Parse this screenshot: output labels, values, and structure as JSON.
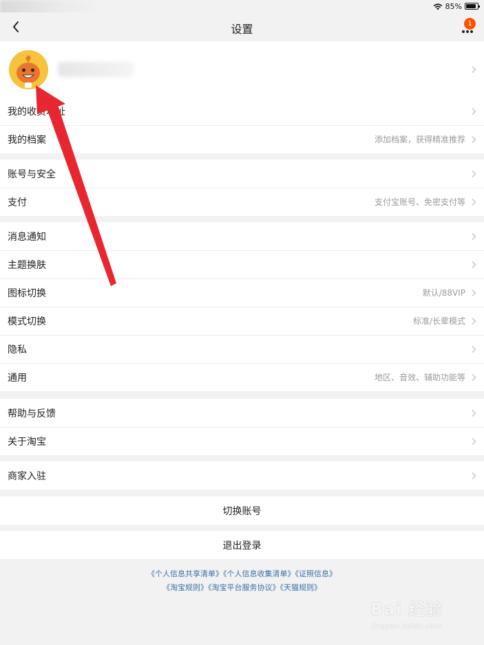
{
  "status_bar": {
    "battery": "85%",
    "battery_level": 0.85,
    "wifi_icon": "wifi-icon"
  },
  "nav": {
    "title": "设置",
    "badge": "1",
    "back_icon": "chevron-left-icon",
    "more_icon": "more-dots-icon"
  },
  "profile": {
    "chevron": "chevron-right-icon"
  },
  "group1": [
    {
      "label": "我的收货地址",
      "hint": ""
    },
    {
      "label": "我的档案",
      "hint": "添加档案，获得精准推荐"
    }
  ],
  "group2": [
    {
      "label": "账号与安全",
      "hint": ""
    },
    {
      "label": "支付",
      "hint": "支付宝账号、免密支付等"
    }
  ],
  "group3": [
    {
      "label": "消息通知",
      "hint": ""
    },
    {
      "label": "主题换肤",
      "hint": ""
    },
    {
      "label": "图标切换",
      "hint": "默认/88VIP"
    },
    {
      "label": "模式切换",
      "hint": "标准/长辈模式"
    },
    {
      "label": "隐私",
      "hint": ""
    },
    {
      "label": "通用",
      "hint": "地区、音效、辅助功能等"
    }
  ],
  "group4": [
    {
      "label": "帮助与反馈",
      "hint": ""
    },
    {
      "label": "关于淘宝",
      "hint": ""
    }
  ],
  "group5": [
    {
      "label": "商家入驻",
      "hint": ""
    }
  ],
  "actions": {
    "switch_account": "切换账号",
    "logout": "退出登录"
  },
  "footer": {
    "line1": [
      "《个人信息共享清单》",
      "《个人信息收集清单》",
      "《证照信息》"
    ],
    "line2": [
      "《淘宝规则》",
      "《淘宝平台服务协议》",
      "《天猫规则》"
    ]
  },
  "watermark": {
    "text": "Bai 经验",
    "url": "jingyan.baidu.com"
  },
  "colors": {
    "accent": "#ff5000",
    "annotation_arrow": "#e8262f",
    "link": "#3d6ea8"
  }
}
